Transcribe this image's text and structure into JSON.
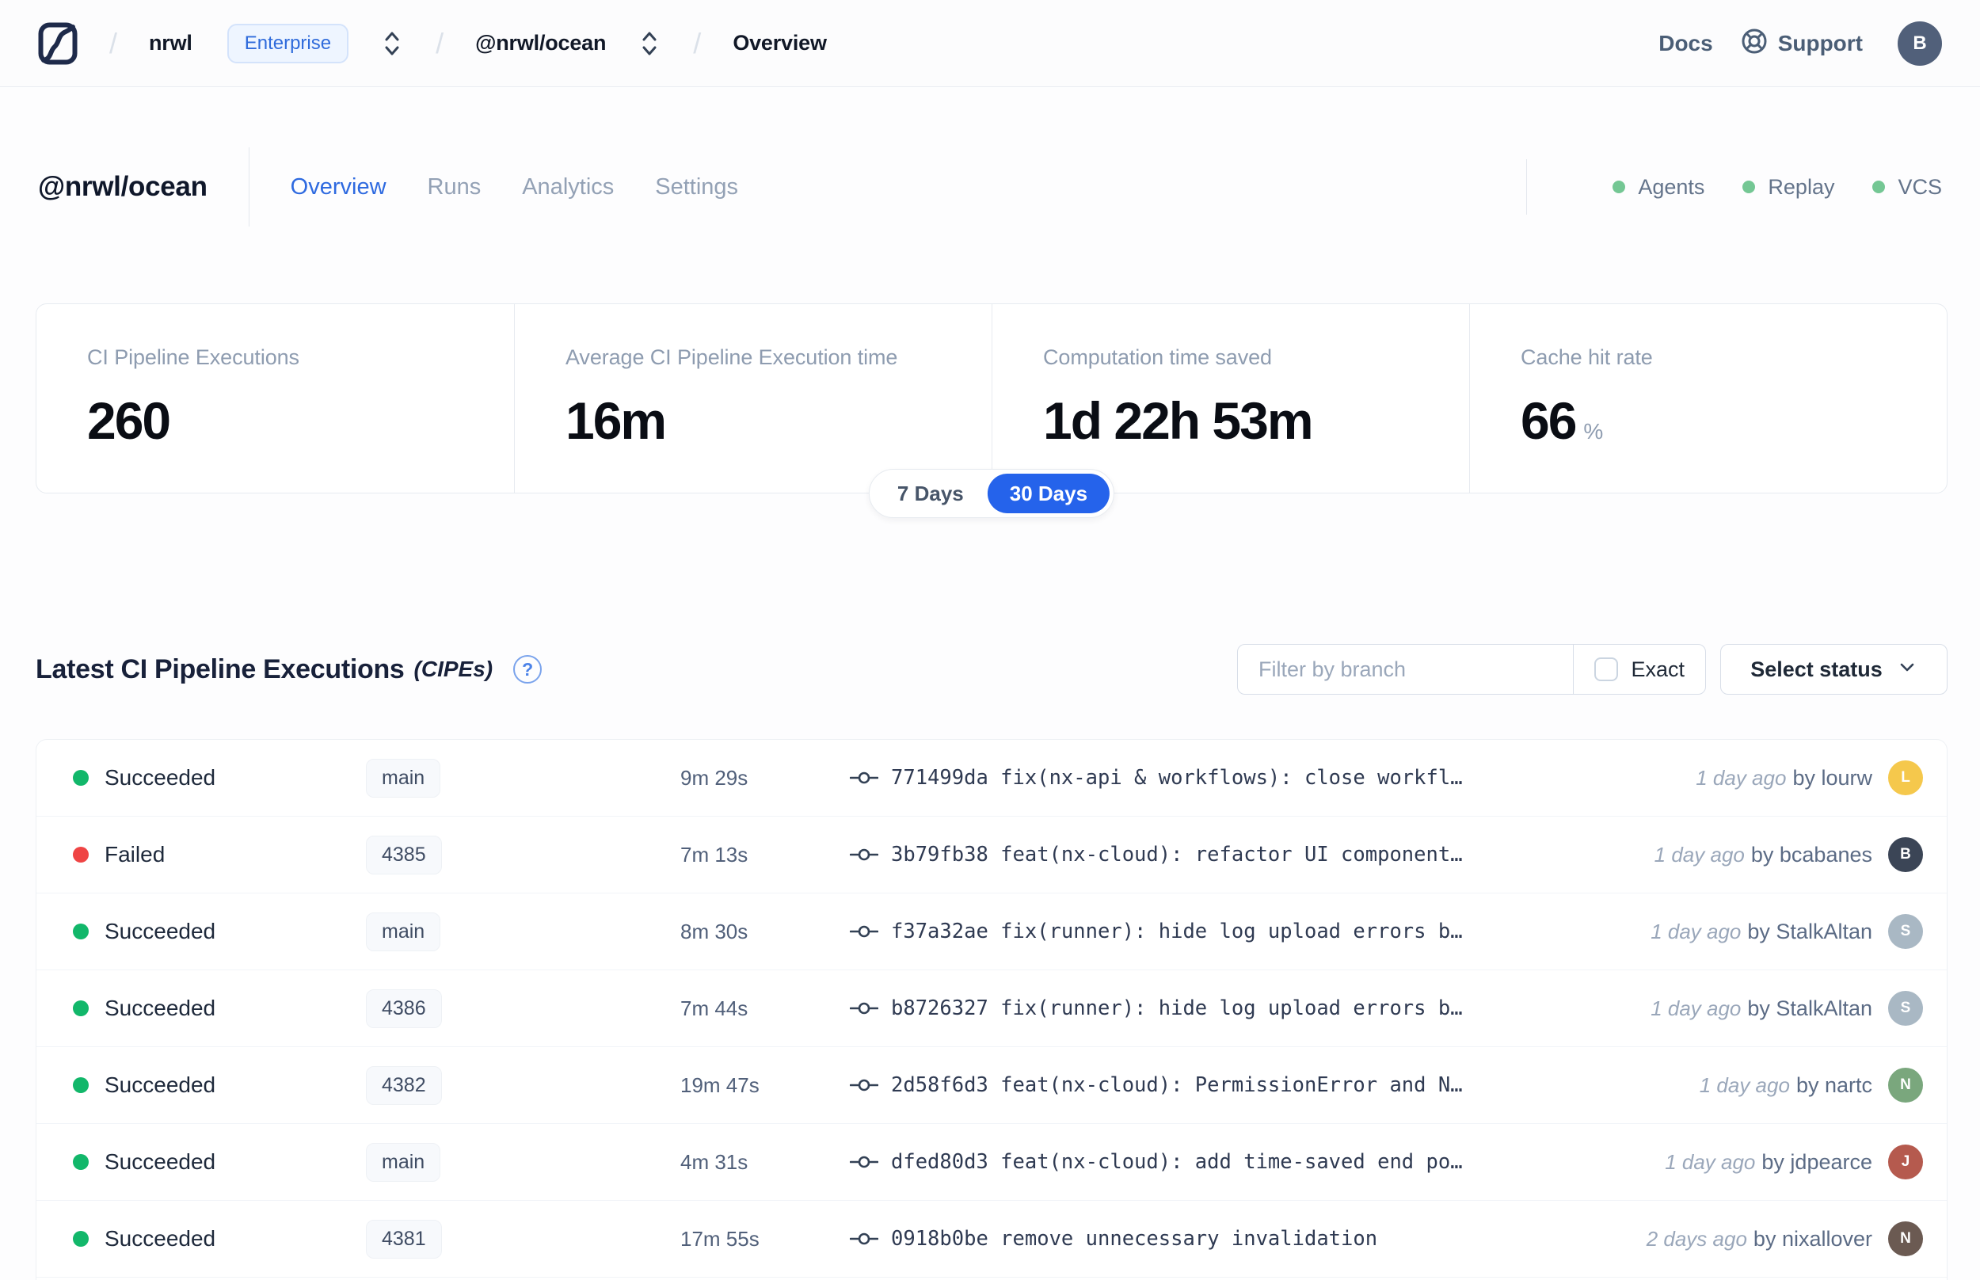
{
  "navbar": {
    "separator": "/",
    "workspace": "nrwl",
    "plan_badge": "Enterprise",
    "project": "@nrwl/ocean",
    "page": "Overview",
    "docs_label": "Docs",
    "support_label": "Support",
    "user_avatar": {
      "initial": "B",
      "color": "#51607a"
    }
  },
  "header": {
    "title": "@nrwl/ocean",
    "tabs": [
      {
        "label": "Overview",
        "active": true
      },
      {
        "label": "Runs",
        "active": false
      },
      {
        "label": "Analytics",
        "active": false
      },
      {
        "label": "Settings",
        "active": false
      }
    ],
    "indicators": [
      {
        "label": "Agents",
        "color": "#74c794"
      },
      {
        "label": "Replay",
        "color": "#74c794"
      },
      {
        "label": "VCS",
        "color": "#74c794"
      }
    ]
  },
  "stats": {
    "cards": [
      {
        "label": "CI Pipeline Executions",
        "value": "260"
      },
      {
        "label": "Average CI Pipeline Execution time",
        "value": "16m"
      },
      {
        "label": "Computation time saved",
        "value": "1d 22h 53m"
      },
      {
        "label": "Cache hit rate",
        "value": "66",
        "unit": "%"
      }
    ],
    "period_options": [
      "7 Days",
      "30 Days"
    ],
    "selected_period": "30 Days"
  },
  "executions": {
    "title": "Latest CI Pipeline Executions",
    "title_suffix": "(CIPEs)",
    "help_glyph": "?",
    "filter_placeholder": "Filter by branch",
    "exact_label": "Exact",
    "status_dropdown_label": "Select status",
    "rows": [
      {
        "status": "Succeeded",
        "dot_color": "#12b76a",
        "branch": "main",
        "duration": "9m 29s",
        "commit": "771499da fix(nx-api & workflows): close workfl…",
        "time": "1 day ago",
        "author": "by lourw",
        "avatar_initial": "L",
        "avatar_color": "#f5c84c"
      },
      {
        "status": "Failed",
        "dot_color": "#ef4444",
        "branch": "4385",
        "duration": "7m 13s",
        "commit": "3b79fb38 feat(nx-cloud): refactor UI component…",
        "time": "1 day ago",
        "author": "by bcabanes",
        "avatar_initial": "B",
        "avatar_color": "#3b4556"
      },
      {
        "status": "Succeeded",
        "dot_color": "#12b76a",
        "branch": "main",
        "duration": "8m 30s",
        "commit": "f37a32ae fix(runner): hide log upload errors b…",
        "time": "1 day ago",
        "author": "by StalkAltan",
        "avatar_initial": "S",
        "avatar_color": "#a9b8c4"
      },
      {
        "status": "Succeeded",
        "dot_color": "#12b76a",
        "branch": "4386",
        "duration": "7m 44s",
        "commit": "b8726327 fix(runner): hide log upload errors b…",
        "time": "1 day ago",
        "author": "by StalkAltan",
        "avatar_initial": "S",
        "avatar_color": "#a9b8c4"
      },
      {
        "status": "Succeeded",
        "dot_color": "#12b76a",
        "branch": "4382",
        "duration": "19m 47s",
        "commit": "2d58f6d3 feat(nx-cloud): PermissionError and N…",
        "time": "1 day ago",
        "author": "by nartc",
        "avatar_initial": "N",
        "avatar_color": "#7aa77d"
      },
      {
        "status": "Succeeded",
        "dot_color": "#12b76a",
        "branch": "main",
        "duration": "4m 31s",
        "commit": "dfed80d3 feat(nx-cloud): add time-saved end po…",
        "time": "1 day ago",
        "author": "by jdpearce",
        "avatar_initial": "J",
        "avatar_color": "#b55a4e"
      },
      {
        "status": "Succeeded",
        "dot_color": "#12b76a",
        "branch": "4381",
        "duration": "17m 55s",
        "commit": "0918b0be remove unnecessary invalidation",
        "time": "2 days ago",
        "author": "by nixallover",
        "avatar_initial": "N",
        "avatar_color": "#6b5a52"
      }
    ]
  },
  "colors": {
    "accent_blue": "#2563eb",
    "success_green": "#12b76a",
    "failed_red": "#ef4444",
    "indicator_green": "#74c794"
  }
}
